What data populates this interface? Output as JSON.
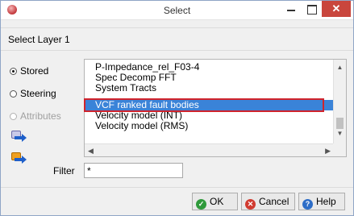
{
  "window": {
    "title": "Select",
    "controls": {
      "minimize": "–",
      "maximize": "□",
      "close": "✕"
    }
  },
  "heading": "Select Layer 1",
  "source_options": [
    {
      "label": "Stored",
      "checked": true,
      "enabled": true
    },
    {
      "label": "Steering",
      "checked": false,
      "enabled": true
    },
    {
      "label": "Attributes",
      "checked": false,
      "enabled": false
    }
  ],
  "layer_list": {
    "items": [
      "P-Impedance_rel_F03-4",
      "Spec Decomp FFT",
      "System Tracts",
      "VCF ranked fault bodies",
      "Velocity model (INT)",
      "Velocity model (RMS)"
    ],
    "selected": "VCF ranked fault bodies"
  },
  "filter": {
    "label": "Filter",
    "value": "*"
  },
  "buttons": {
    "ok": "OK",
    "cancel": "Cancel",
    "help": "Help"
  },
  "icons": {
    "window": "app-icon",
    "select_sequence": "select-sequence-icon",
    "select_other": "select-other-icon"
  },
  "colors": {
    "selection": "#3a83d8",
    "highlight_frame": "#d0232c",
    "close_button": "#c9463d"
  }
}
